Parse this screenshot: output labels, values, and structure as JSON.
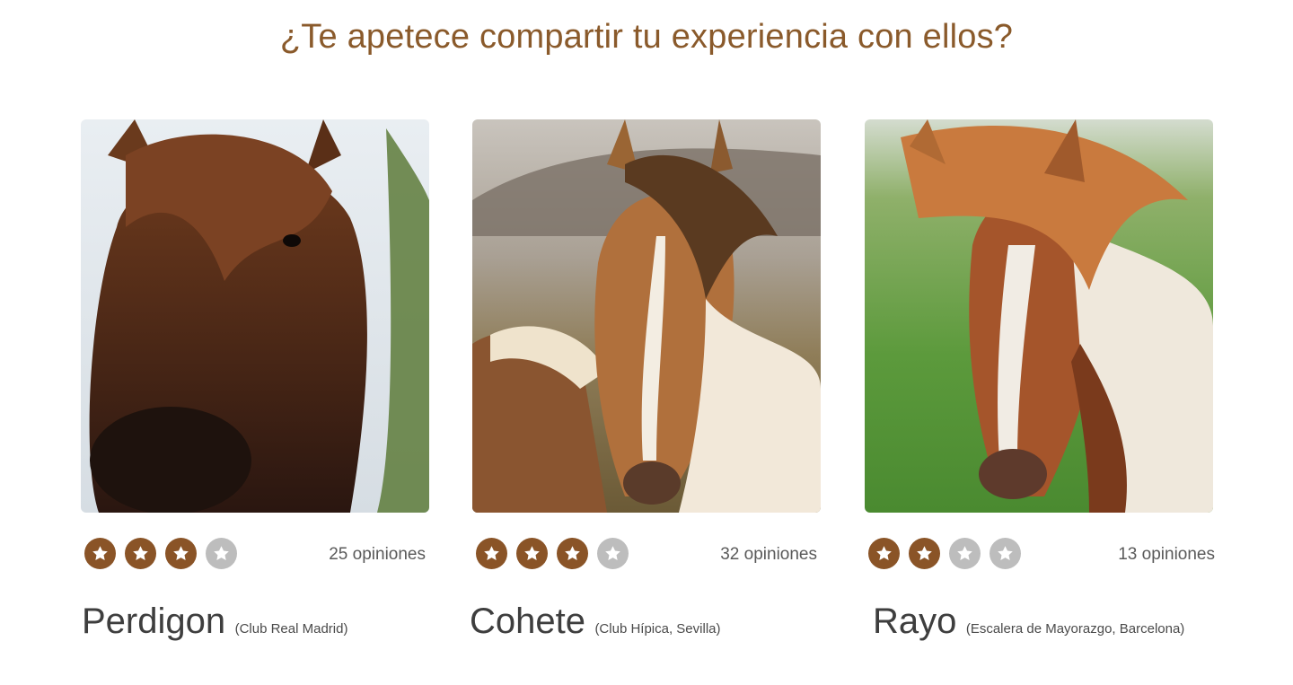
{
  "heading": "¿Te apetece compartir tu experiencia con ellos?",
  "colors": {
    "accent": "#8a5a2b",
    "star_filled": "#8a5427",
    "star_empty": "#bdbdbd"
  },
  "horses": [
    {
      "name": "Perdigon",
      "club": "(Club Real Madrid)",
      "reviews": "25 opiniones",
      "rating": 3,
      "rating_max": 4
    },
    {
      "name": "Cohete",
      "club": "(Club Hípica, Sevilla)",
      "reviews": "32 opiniones",
      "rating": 3,
      "rating_max": 4
    },
    {
      "name": "Rayo",
      "club": "(Escalera de Mayorazgo, Barcelona)",
      "reviews": "13 opiniones",
      "rating": 2,
      "rating_max": 4
    }
  ]
}
